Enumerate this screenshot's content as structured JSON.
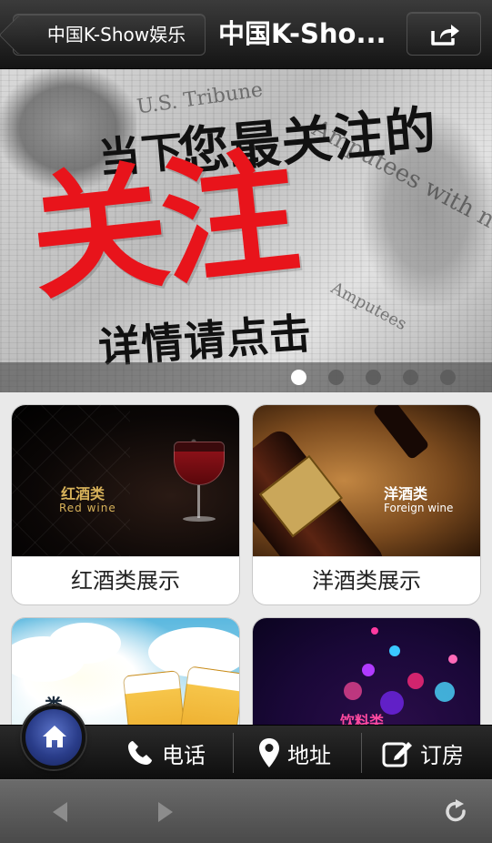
{
  "header": {
    "back_label": "中国K-Show娱乐",
    "title": "中国K-Sho..."
  },
  "banner": {
    "headline_small": "当下",
    "headline_main": "您最关注的",
    "headline_big": "关注",
    "headline_cta": "详情请点击",
    "news_text_1": "Amputees with no place to go fill",
    "news_text_2": "U.S. Tribune",
    "news_text_3": "Amputees",
    "slide_count": 5,
    "active_slide": 1
  },
  "categories": [
    {
      "label": "红酒类展示",
      "image_cn": "红酒类",
      "image_en": "Red wine"
    },
    {
      "label": "洋酒类展示",
      "image_cn": "洋酒类",
      "image_en": "Foreign wine"
    },
    {
      "label": "",
      "image_cn": "类",
      "image_en": ""
    },
    {
      "label": "",
      "image_cn": "饮料类",
      "image_en": ""
    }
  ],
  "toolbar": {
    "phone_label": "电话",
    "address_label": "地址",
    "order_label": "订房"
  },
  "colors": {
    "headline_red": "#e8141b",
    "home_button_blue": "#2a3d8a"
  },
  "icons": {
    "back": "chevron-left-icon",
    "share": "share-icon",
    "home": "home-icon",
    "phone": "phone-icon",
    "address": "map-pin-icon",
    "order": "edit-icon",
    "browser_back": "arrow-left-icon",
    "browser_forward": "arrow-right-icon",
    "reload": "reload-icon"
  }
}
